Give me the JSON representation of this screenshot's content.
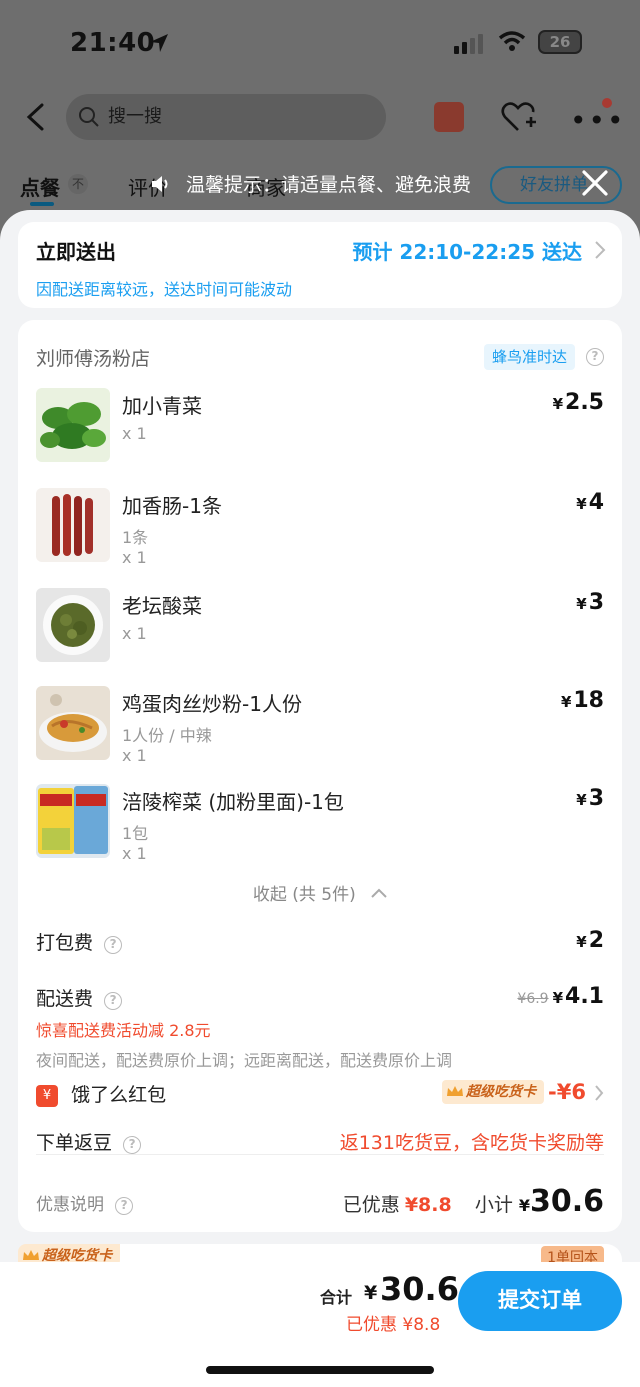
{
  "status_bar": {
    "time": "21:40",
    "battery": "26"
  },
  "header": {
    "search_placeholder": "搜一搜"
  },
  "tabs": {
    "order": "点餐",
    "order_badge": "不",
    "review": "评价",
    "shop": "商家",
    "friend_button": "好友拼单"
  },
  "notice": {
    "text": "温馨提示：请适量点餐、避免浪费"
  },
  "delivery": {
    "title": "立即送出",
    "eta": "预计 22:10-22:25 送达",
    "note": "因配送距离较远，送达时间可能波动"
  },
  "shop": {
    "name": "刘师傅汤粉店",
    "badge": "蜂鸟准时达"
  },
  "items": [
    {
      "name": "加小青菜",
      "spec": "",
      "qty": "x 1",
      "price": "2.5"
    },
    {
      "name": "加香肠-1条",
      "spec": "1条",
      "qty": "x 1",
      "price": "4"
    },
    {
      "name": "老坛酸菜",
      "spec": "",
      "qty": "x 1",
      "price": "3"
    },
    {
      "name": "鸡蛋肉丝炒粉-1人份",
      "spec": "1人份 / 中辣",
      "qty": "x 1",
      "price": "18"
    },
    {
      "name": "涪陵榨菜 (加粉里面)-1包",
      "spec": "1包",
      "qty": "x 1",
      "price": "3"
    }
  ],
  "currency": "¥",
  "collapse_text": "收起 (共 5件)",
  "packing": {
    "label": "打包费",
    "price": "2"
  },
  "delivery_fee": {
    "label": "配送费",
    "original": "¥6.9",
    "price": "4.1",
    "promo": "惊喜配送费活动减 2.8元",
    "note": "夜间配送，配送费原价上调；远距离配送，配送费原价上调"
  },
  "red_packet": {
    "icon_text": "¥",
    "label": "饿了么红包",
    "vip_tag": "超级吃货卡",
    "amount": "-¥6"
  },
  "beans": {
    "label": "下单返豆",
    "value": "返131吃货豆，含吃货卡奖励等"
  },
  "summary": {
    "disc_label": "优惠说明",
    "saved_label": "已优惠",
    "saved": "¥8.8",
    "subtotal_label": "小计",
    "subtotal": "30.6"
  },
  "peek": {
    "vip_tag": "超级吃货卡",
    "right_tag": "1单回本"
  },
  "bottom": {
    "total_label": "合计",
    "total": "30.6",
    "discount": "已优惠 ¥8.8",
    "submit": "提交订单"
  },
  "colors": {
    "accent": "#1a9ef0",
    "red": "#f04b2e"
  }
}
